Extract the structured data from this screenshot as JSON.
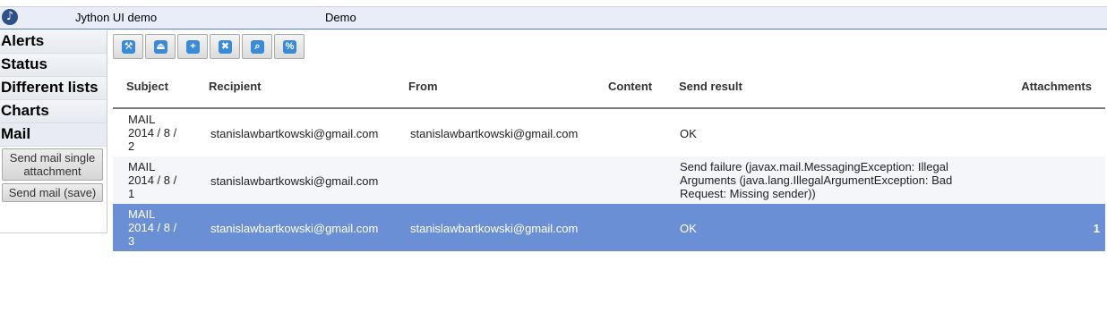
{
  "header": {
    "logo_glyph": "♪",
    "app_title": "Jython UI demo",
    "module_title": "Demo"
  },
  "sidebar": {
    "items": [
      {
        "label": "Alerts"
      },
      {
        "label": "Status"
      },
      {
        "label": "Different lists"
      },
      {
        "label": "Charts"
      },
      {
        "label": "Mail",
        "active": true
      }
    ],
    "sub_buttons": [
      {
        "label": "Send mail single attachment"
      },
      {
        "label": "Send mail (save)"
      }
    ]
  },
  "toolbar": {
    "buttons": [
      {
        "icon": "wrench-icon",
        "glyph": "🔧"
      },
      {
        "icon": "eject-icon",
        "glyph": "⏏"
      },
      {
        "icon": "add-icon",
        "glyph": "+"
      },
      {
        "icon": "trash-icon",
        "glyph": "🗑"
      },
      {
        "icon": "search-icon",
        "glyph": "🔍"
      },
      {
        "icon": "percent-icon",
        "glyph": "%"
      }
    ]
  },
  "table": {
    "columns": [
      "Subject",
      "Recipient",
      "From",
      "Content",
      "Send result",
      "Attachments"
    ],
    "rows": [
      {
        "subject": [
          "MAIL",
          "2014 / 8 /",
          "2"
        ],
        "recipient": "stanislawbartkowski@gmail.com",
        "from": "stanislawbartkowski@gmail.com",
        "content": "",
        "send_result": [
          "OK"
        ],
        "attachments": ""
      },
      {
        "subject": [
          "MAIL",
          "2014 / 8 /",
          "1"
        ],
        "recipient": "stanislawbartkowski@gmail.com",
        "from": "",
        "content": "",
        "send_result": [
          "Send failure (javax.mail.MessagingException: Illegal",
          "Arguments (java.lang.IllegalArgumentException: Bad",
          "Request: Missing sender))"
        ],
        "attachments": ""
      },
      {
        "subject": [
          "MAIL",
          "2014 / 8 /",
          "3"
        ],
        "recipient": "stanislawbartkowski@gmail.com",
        "from": "stanislawbartkowski@gmail.com",
        "content": "",
        "send_result": [
          "OK"
        ],
        "attachments": "1",
        "selected": true
      }
    ]
  },
  "colors": {
    "accent": "#5b7fc7",
    "selected_row": "#6b8fd4",
    "toolbar_icon": "#3a8ad8"
  }
}
